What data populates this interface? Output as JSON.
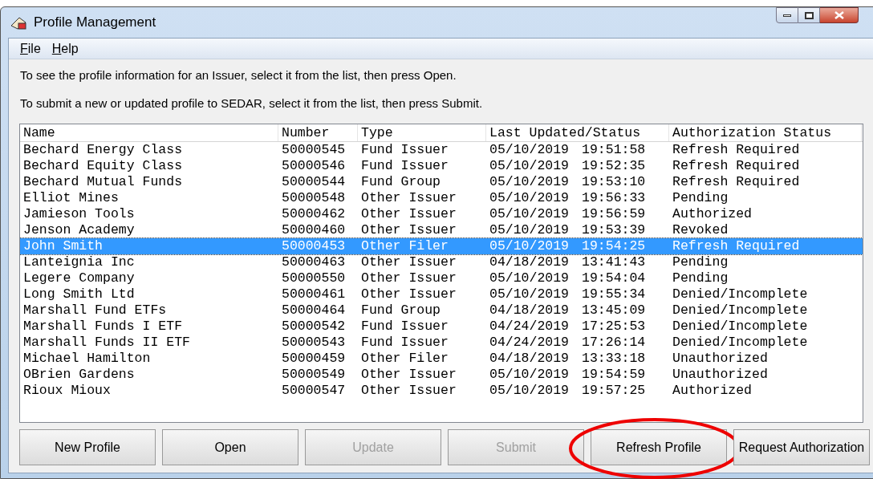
{
  "window": {
    "title": "Profile Management"
  },
  "menu": [
    {
      "label": "File"
    },
    {
      "label": "Help"
    }
  ],
  "instructions": [
    "To see the profile information for an Issuer, select it from the list, then press Open.",
    "To submit a new or updated profile to SEDAR, select it from the list, then press Submit."
  ],
  "table": {
    "columns": [
      "Name",
      "Number",
      "Type",
      "Last Updated/Status",
      "Authorization Status"
    ],
    "rows": [
      {
        "name": "Bechard Energy Class",
        "number": "50000545",
        "type": "Fund Issuer",
        "date": "05/10/2019",
        "time": "19:51:58",
        "auth": "Refresh Required",
        "selected": false
      },
      {
        "name": "Bechard Equity Class",
        "number": "50000546",
        "type": "Fund Issuer",
        "date": "05/10/2019",
        "time": "19:52:35",
        "auth": "Refresh Required",
        "selected": false
      },
      {
        "name": "Bechard Mutual Funds",
        "number": "50000544",
        "type": "Fund Group",
        "date": "05/10/2019",
        "time": "19:53:10",
        "auth": "Refresh Required",
        "selected": false
      },
      {
        "name": "Elliot Mines",
        "number": "50000548",
        "type": "Other Issuer",
        "date": "05/10/2019",
        "time": "19:56:33",
        "auth": "Pending",
        "selected": false
      },
      {
        "name": "Jamieson Tools",
        "number": "50000462",
        "type": "Other Issuer",
        "date": "05/10/2019",
        "time": "19:56:59",
        "auth": "Authorized",
        "selected": false
      },
      {
        "name": "Jenson Academy",
        "number": "50000460",
        "type": "Other Issuer",
        "date": "05/10/2019",
        "time": "19:53:39",
        "auth": "Revoked",
        "selected": false
      },
      {
        "name": "John Smith",
        "number": "50000453",
        "type": "Other Filer",
        "date": "05/10/2019",
        "time": "19:54:25",
        "auth": "Refresh Required",
        "selected": true
      },
      {
        "name": "Lanteignia Inc",
        "number": "50000463",
        "type": "Other Issuer",
        "date": "04/18/2019",
        "time": "13:41:43",
        "auth": "Pending",
        "selected": false
      },
      {
        "name": "Legere Company",
        "number": "50000550",
        "type": "Other Issuer",
        "date": "05/10/2019",
        "time": "19:54:04",
        "auth": "Pending",
        "selected": false
      },
      {
        "name": "Long Smith Ltd",
        "number": "50000461",
        "type": "Other Issuer",
        "date": "05/10/2019",
        "time": "19:55:34",
        "auth": "Denied/Incomplete",
        "selected": false
      },
      {
        "name": "Marshall Fund ETFs",
        "number": "50000464",
        "type": "Fund Group",
        "date": "04/18/2019",
        "time": "13:45:09",
        "auth": "Denied/Incomplete",
        "selected": false
      },
      {
        "name": "Marshall Funds I ETF",
        "number": "50000542",
        "type": "Fund Issuer",
        "date": "04/24/2019",
        "time": "17:25:53",
        "auth": "Denied/Incomplete",
        "selected": false
      },
      {
        "name": "Marshall Funds II ETF",
        "number": "50000543",
        "type": "Fund Issuer",
        "date": "04/24/2019",
        "time": "17:26:14",
        "auth": "Denied/Incomplete",
        "selected": false
      },
      {
        "name": "Michael Hamilton",
        "number": "50000459",
        "type": "Other Filer",
        "date": "04/18/2019",
        "time": "13:33:18",
        "auth": "Unauthorized",
        "selected": false
      },
      {
        "name": "OBrien Gardens",
        "number": "50000549",
        "type": "Other Issuer",
        "date": "05/10/2019",
        "time": "19:54:59",
        "auth": "Unauthorized",
        "selected": false
      },
      {
        "name": "Rioux Mioux",
        "number": "50000547",
        "type": "Other Issuer",
        "date": "05/10/2019",
        "time": "19:57:25",
        "auth": "Authorized",
        "selected": false
      }
    ]
  },
  "buttons": [
    {
      "label": "New Profile",
      "disabled": false,
      "highlighted": false
    },
    {
      "label": "Open",
      "disabled": false,
      "highlighted": false
    },
    {
      "label": "Update",
      "disabled": true,
      "highlighted": false
    },
    {
      "label": "Submit",
      "disabled": true,
      "highlighted": false
    },
    {
      "label": "Refresh Profile",
      "disabled": false,
      "highlighted": true
    },
    {
      "label": "Request Authorization",
      "disabled": false,
      "highlighted": false
    }
  ]
}
